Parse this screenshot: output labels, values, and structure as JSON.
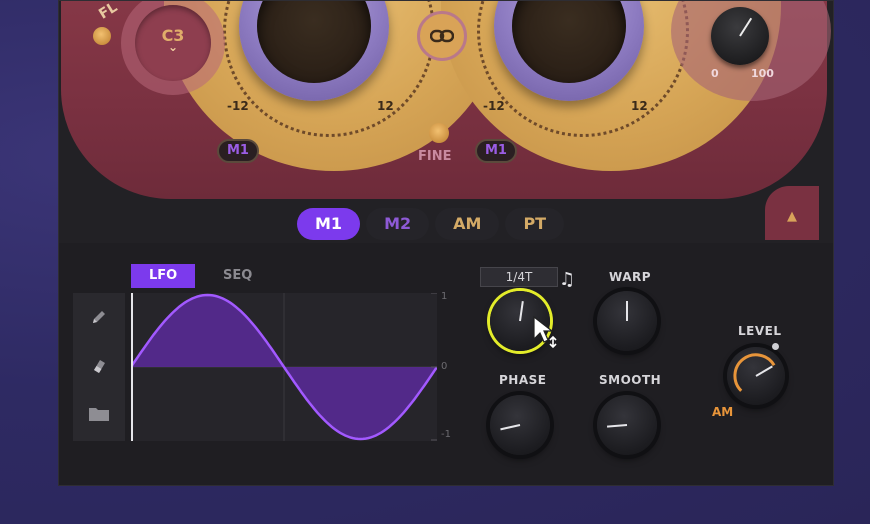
{
  "header": {
    "fl_label": "FL",
    "pitch_note": "C3",
    "pitch_chevron": "⌄",
    "coarse_scale": {
      "min": "-12",
      "max": "12"
    },
    "fine_scale": {
      "min": "-12",
      "max": "12"
    },
    "fine_label": "FINE",
    "mod_badge_left": "M1",
    "mod_badge_right": "M1",
    "mix_scale": {
      "min": "0",
      "max": "100"
    },
    "mix_value": 0.62
  },
  "mod_tabs": [
    {
      "label": "M1",
      "active": true
    },
    {
      "label": "M2",
      "active": false
    },
    {
      "label": "AM",
      "active": false
    },
    {
      "label": "PT",
      "active": false
    }
  ],
  "collapse_glyph": "▲",
  "lfo": {
    "mode_tabs": {
      "lfo": "LFO",
      "seq": "SEQ"
    },
    "active_mode": "LFO",
    "range_labels": {
      "top": "1",
      "mid": "0",
      "bottom": "-1"
    },
    "shape": "sine",
    "rate": {
      "value": "1/4T",
      "sync_icon": "♫"
    },
    "knobs": {
      "warp": {
        "label": "WARP",
        "value": 0.5
      },
      "phase": {
        "label": "PHASE",
        "value": 0.12
      },
      "smooth": {
        "label": "SMOOTH",
        "value": 0.15
      },
      "level": {
        "label": "LEVEL",
        "value": 0.72,
        "mod_label": "AM"
      },
      "rate": {
        "value": 0.53
      }
    }
  },
  "colors": {
    "accent": "#7c3aed",
    "gold": "#d6a556",
    "maroon": "#7a3141",
    "highlight": "#e3ec2a",
    "level_arc": "#e8953a"
  }
}
